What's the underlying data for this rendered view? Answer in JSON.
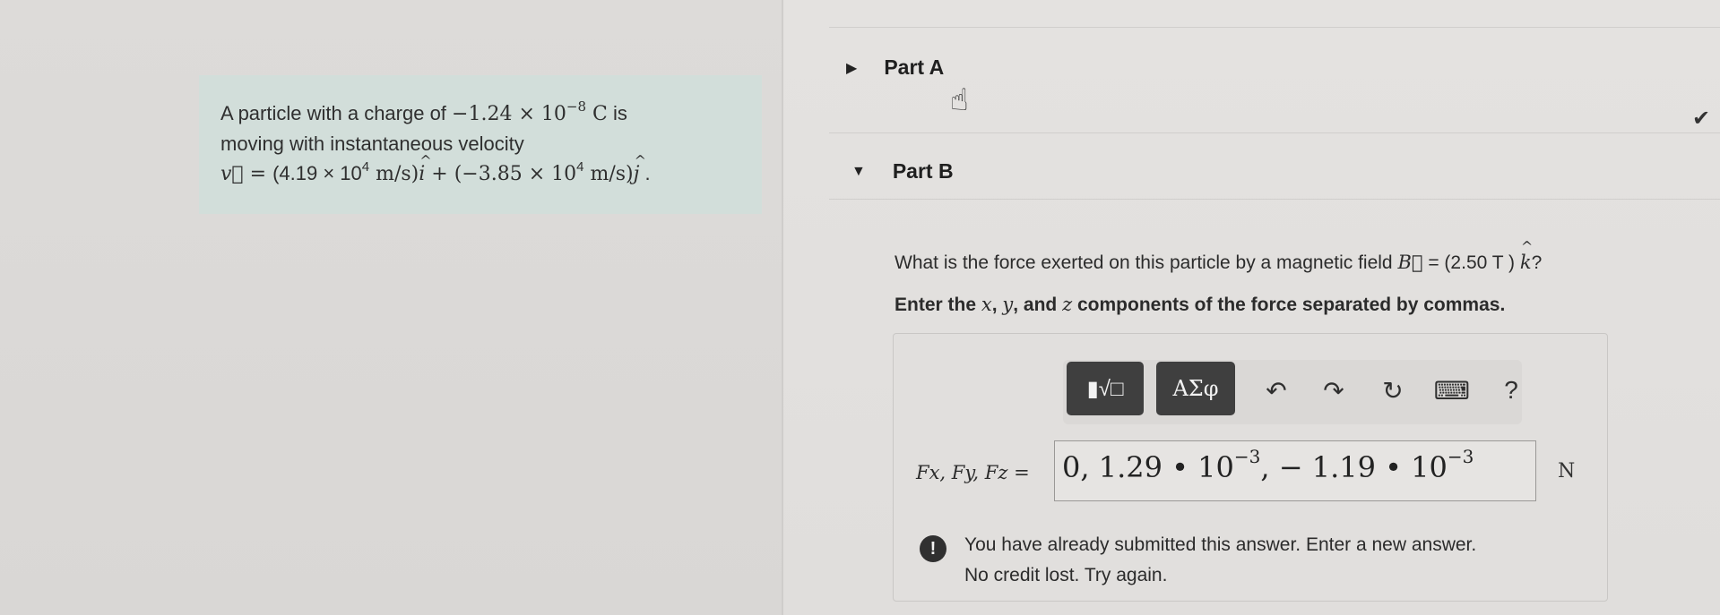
{
  "problem": {
    "line1_text": "A particle with a charge of ",
    "charge_value": "−1.24 × 10",
    "charge_exp": "−8",
    "charge_unit": " C",
    "line1_end": " is",
    "line2": "moving with instantaneous velocity",
    "velocity_lhs": "v⃗ = ",
    "vx_coeff": "(4.19 × 10",
    "vx_exp": "4",
    "vx_unit": " m/s)",
    "i_hat": "i",
    "plus": " + ",
    "vy_coeff": "(−3.85 × 10",
    "vy_exp": "4",
    "vy_unit": " m/s)",
    "j_hat": "j",
    "period": " ."
  },
  "parts": {
    "part_a": "Part A",
    "part_b": "Part B"
  },
  "question": {
    "text_start": "What is the force exerted on this particle by a magnetic field ",
    "b_vec": "B⃗",
    "text_mid": " = (2.50  T ) ",
    "k_hat": "k",
    "text_end": "?"
  },
  "instruction": {
    "start": "Enter the ",
    "x": "x",
    "sep1": ", ",
    "y": "y",
    "sep2": ", and ",
    "z": "z",
    "end": " components of the force separated by commas."
  },
  "toolbar": {
    "templates_icon": "▮√□",
    "greek_label": "ΑΣφ",
    "undo_icon": "↶",
    "redo_icon": "↷",
    "reset_icon": "↻",
    "keyboard_icon": "⌨",
    "help_icon": "?"
  },
  "answer": {
    "label": "Fx, Fy, Fz =",
    "value_part1": "0, 1.29 • 10",
    "exp1": "−3",
    "value_part2": ", − 1.19 • 10",
    "exp2": "−3",
    "unit": "N"
  },
  "feedback": {
    "icon": "!",
    "line1": "You have already submitted this answer. Enter a new answer.",
    "line2": "No credit lost. Try again."
  },
  "status": {
    "part_a_check": "✔"
  }
}
